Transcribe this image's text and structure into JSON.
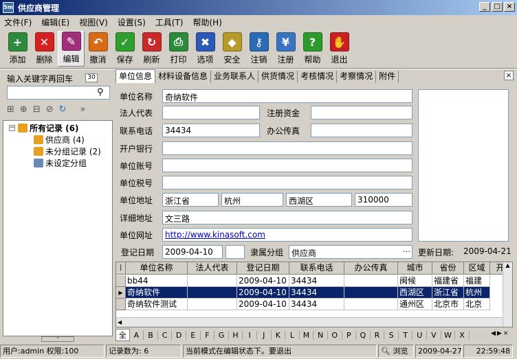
{
  "window": {
    "title": "供应商管理"
  },
  "menu": [
    "文件(F)",
    "编辑(E)",
    "视图(V)",
    "设置(S)",
    "工具(T)",
    "帮助(H)"
  ],
  "toolbar": [
    {
      "label": "添加",
      "icon": "add-icon",
      "color": "#2e8b3d"
    },
    {
      "label": "删除",
      "icon": "delete-icon",
      "color": "#d42020"
    },
    {
      "label": "编辑",
      "icon": "edit-icon",
      "color": "#a0307c"
    },
    {
      "label": "撤消",
      "icon": "undo-icon",
      "color": "#d86a16"
    },
    {
      "label": "保存",
      "icon": "save-icon",
      "color": "#2f9e2f"
    },
    {
      "label": "刷新",
      "icon": "refresh-icon",
      "color": "#c82a2a"
    },
    {
      "label": "打印",
      "icon": "print-icon",
      "color": "#2b8a3b"
    },
    {
      "label": "选项",
      "icon": "options-icon",
      "color": "#2a59b8"
    },
    {
      "label": "安全",
      "icon": "security-icon",
      "color": "#b89a2a"
    },
    {
      "label": "注销",
      "icon": "logout-icon",
      "color": "#2a6bb8"
    },
    {
      "label": "注册",
      "icon": "register-icon",
      "color": "#3a73c0"
    },
    {
      "label": "帮助",
      "icon": "help-icon",
      "color": "#2c9b2c"
    },
    {
      "label": "退出",
      "icon": "exit-icon",
      "color": "#c82020"
    }
  ],
  "search": {
    "label": "输入关键字再回车",
    "badge": "30",
    "value": ""
  },
  "tree": {
    "root": "所有记录 (6)",
    "children": [
      "供应商 (4)",
      "未分组记录 (2)",
      "未设定分组"
    ]
  },
  "tabs": [
    "单位信息",
    "材料设备信息",
    "业务联系人",
    "供货情况",
    "考核情况",
    "考察情况",
    "附件"
  ],
  "form": {
    "company_label": "单位名称",
    "company": "奇纳软件",
    "legal_label": "法人代表",
    "legal": "",
    "capital_label": "注册资金",
    "capital": "",
    "phone_label": "联系电话",
    "phone": "34434",
    "fax_label": "办公传真",
    "fax": "",
    "bank_label": "开户银行",
    "bank": "",
    "account_label": "单位账号",
    "account": "",
    "tax_label": "单位税号",
    "tax": "",
    "address_label": "单位地址",
    "province": "浙江省",
    "city": "杭州",
    "district": "西湖区",
    "zip": "310000",
    "detail_label": "详细地址",
    "detail": "文三路",
    "web_label": "单位网址",
    "web": "http://www.kinasoft.com",
    "regdate_label": "登记日期",
    "regdate": "2009-04-10",
    "group_label": "隶属分组",
    "group": "供应商",
    "update_label": "更新日期:",
    "update": "2009-04-21"
  },
  "grid": {
    "headers": [
      "单位名称",
      "法人代表",
      "登记日期",
      "联系电话",
      "办公传真",
      "城市",
      "省份",
      "区域",
      "开"
    ],
    "rows": [
      [
        "bb44",
        "",
        "2009-04-10",
        "34434",
        "",
        "闽候",
        "福建省",
        "福建"
      ],
      [
        "奇纳软件",
        "",
        "2009-04-10",
        "34434",
        "",
        "西湖区",
        "浙江省",
        "杭州"
      ],
      [
        "奇纳软件测试",
        "",
        "2009-04-10",
        "34434",
        "",
        "通州区",
        "北京市",
        "北京"
      ]
    ],
    "selected_row": 1
  },
  "alphabet": [
    "全",
    "A",
    "B",
    "C",
    "D",
    "E",
    "F",
    "G",
    "H",
    "I",
    "J",
    "K",
    "L",
    "M",
    "N",
    "O",
    "P",
    "Q",
    "R",
    "S",
    "T",
    "U",
    "V",
    "W",
    "X"
  ],
  "status": {
    "user": "用户:admin 权限:100",
    "count": "记录数为: 6",
    "mode": "当前模式在编辑状态下。要退出",
    "browse": "浏览",
    "date": "2009-04-27",
    "time": "22:59:48"
  }
}
